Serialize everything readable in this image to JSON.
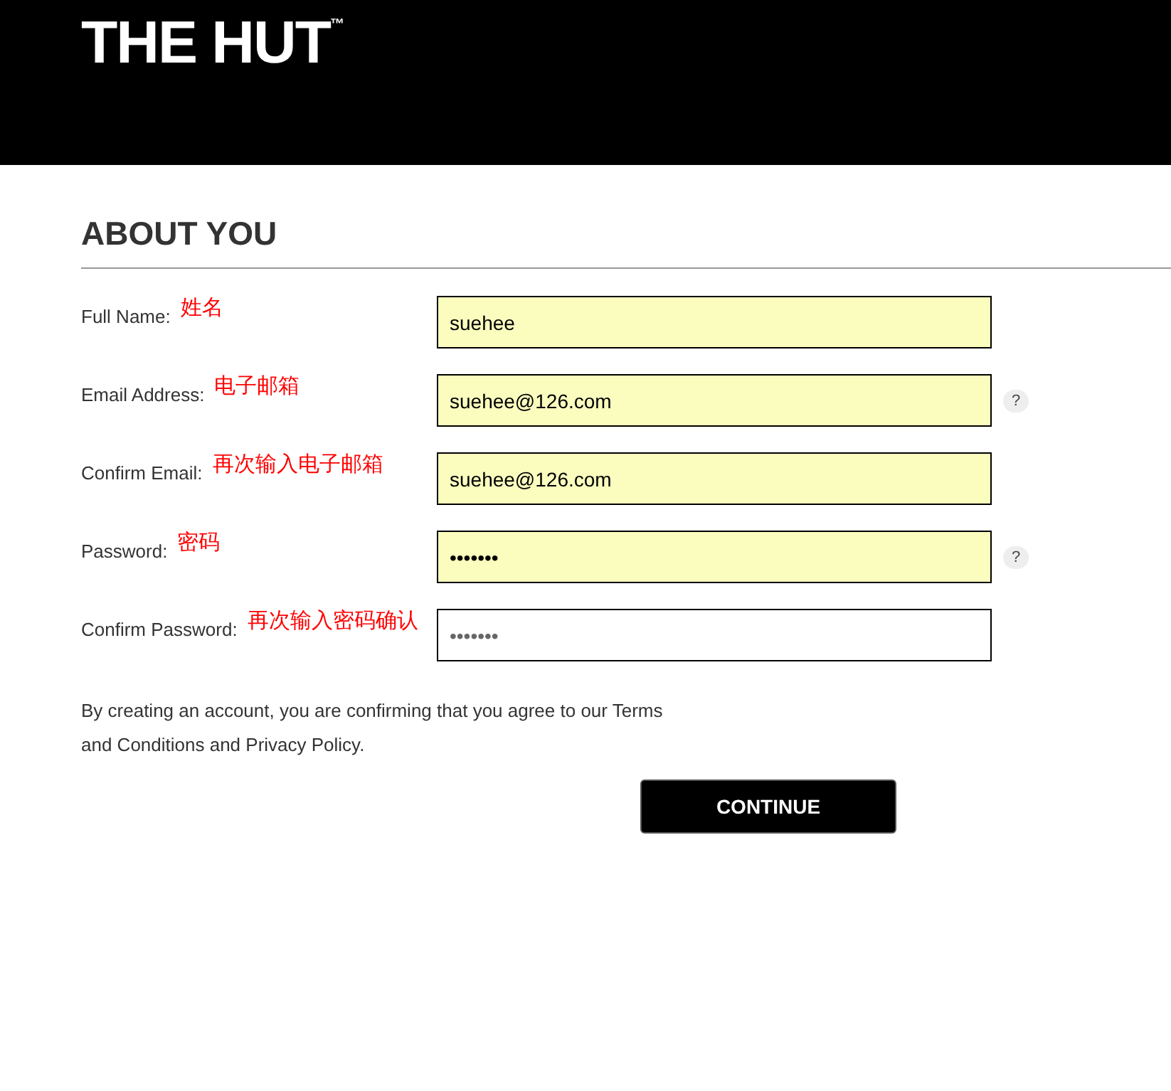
{
  "header": {
    "logo": "THE HUT",
    "logo_mark": "™"
  },
  "title": "ABOUT YOU",
  "fields": [
    {
      "label": "Full Name:",
      "annotation": "姓名",
      "value": "suehee",
      "autofilled": true
    },
    {
      "label": "Email Address:",
      "annotation": "电子邮箱",
      "value": "suehee@126.com",
      "autofilled": true,
      "help": "?"
    },
    {
      "label": "Confirm Email:",
      "annotation": "再次输入电子邮箱",
      "value": "suehee@126.com",
      "autofilled": true
    },
    {
      "label": "Password:",
      "annotation": "密码",
      "value": "•••••••",
      "autofilled": true,
      "help": "?"
    },
    {
      "label": "Confirm Password:",
      "annotation": "再次输入密码确认",
      "value": "•••••••",
      "autofilled": false
    }
  ],
  "terms_line_1": "By creating an account, you are confirming that you agree to our Terms",
  "terms_line_2": "and Conditions and Privacy Policy.",
  "continue_button": "CONTINUE"
}
